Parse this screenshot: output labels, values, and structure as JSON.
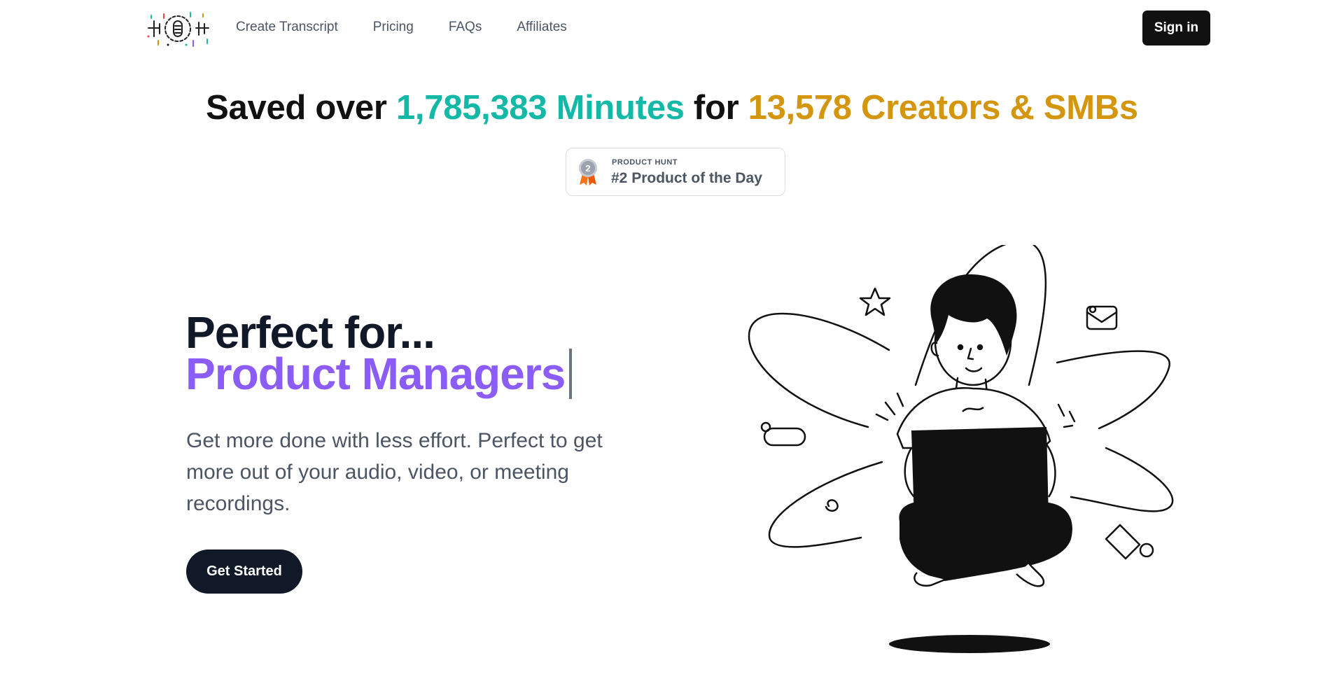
{
  "nav": {
    "logo_icon": "waveform-microphone-logo",
    "links": [
      {
        "label": "Create Transcript"
      },
      {
        "label": "Pricing"
      },
      {
        "label": "FAQs"
      },
      {
        "label": "Affiliates"
      }
    ],
    "signin_label": "Sign in"
  },
  "headline": {
    "part1": "Saved over ",
    "minutes_count": "1,785,383",
    "minutes_label": " Minutes",
    "part2": " for ",
    "creators": "13,578 Creators & SMBs"
  },
  "badge": {
    "icon": "medal-icon",
    "medal_number": "2",
    "kicker": "PRODUCT HUNT",
    "title": "#2 Product of the Day"
  },
  "hero": {
    "title_line1": "Perfect for...",
    "title_line2": "Product Managers",
    "subtitle": "Get more done with less effort. Perfect to get more out of your audio, video, or meeting recordings.",
    "cta_label": "Get Started"
  },
  "colors": {
    "teal": "#14b8a6",
    "gold": "#d4950f",
    "purple": "#8b5cf6",
    "dark": "#111827"
  }
}
